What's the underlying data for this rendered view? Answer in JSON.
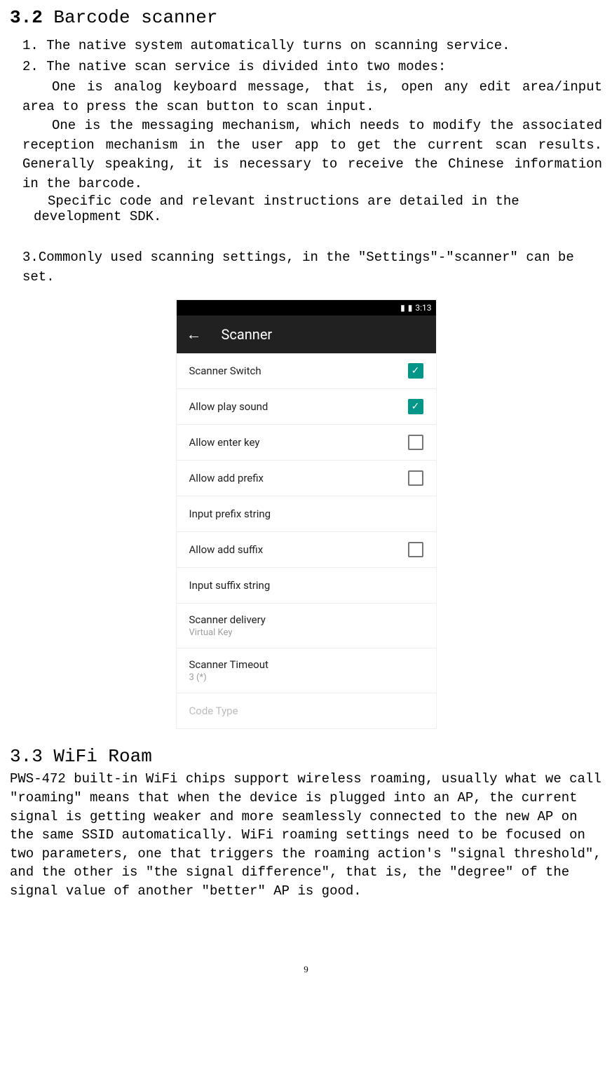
{
  "section32": {
    "number": "3.2",
    "title": "Barcode scanner",
    "item1_num": "1.",
    "item1": "The native system automatically turns on scanning service.",
    "item2_num": "2.",
    "item2": "The native scan service is divided into two modes:",
    "item2a": "One is analog keyboard message, that is, open any edit area/input area to press the scan button to scan input.",
    "item2b": "One is the messaging mechanism, which needs to modify    the associated reception mechanism in the user app to get the current scan results. Generally speaking, it is necessary to receive the Chinese information in the barcode.",
    "item2c": "Specific code and relevant instructions are detailed in the development SDK.",
    "item3_num": "3.",
    "item3": "Commonly used scanning settings, in the \"Settings\"-\"scanner\" can be set."
  },
  "phone": {
    "statusbar_time": "3:13",
    "appbar_title": "Scanner",
    "rows": {
      "scanner_switch": "Scanner Switch",
      "allow_play_sound": "Allow play sound",
      "allow_enter_key": "Allow enter key",
      "allow_add_prefix": "Allow add prefix",
      "input_prefix_string": "Input prefix string",
      "allow_add_suffix": "Allow add suffix",
      "input_suffix_string": "Input suffix string",
      "scanner_delivery": "Scanner delivery",
      "scanner_delivery_sub": "Virtual Key",
      "scanner_timeout": "Scanner Timeout",
      "scanner_timeout_sub": "3 (*)",
      "code_type": "Code Type"
    }
  },
  "section33": {
    "heading": "3.3 WiFi Roam",
    "body": "PWS-472 built-in WiFi chips support wireless roaming, usually what we call \"roaming\" means that when the device is plugged into an AP, the current signal is getting weaker and more seamlessly connected to the new AP on the same SSID automatically. WiFi roaming settings need to be focused on two parameters, one that triggers the roaming action's \"signal threshold\", and the other is \"the signal difference\", that is, the \"degree\" of the signal value of another \"better\" AP is good."
  },
  "footer": {
    "page": "9"
  }
}
